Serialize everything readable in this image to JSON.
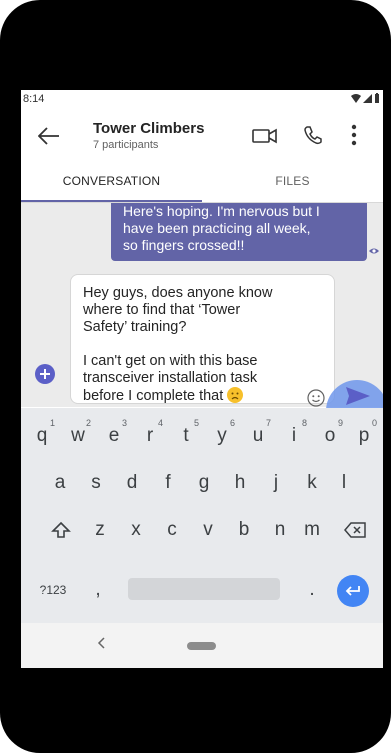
{
  "status_bar": {
    "time": "8:14"
  },
  "header": {
    "title": "Tower Climbers",
    "subtitle": "7 participants"
  },
  "tabs": [
    {
      "label": "CONVERSATION",
      "active": true
    },
    {
      "label": "FILES",
      "active": false
    }
  ],
  "messages": [
    {
      "type": "sent",
      "lines": [
        "Here's hoping. I'm nervous but I",
        "have been practicing all week,",
        "so fingers crossed!!"
      ]
    }
  ],
  "compose": {
    "lines": [
      "Hey guys, does anyone know",
      "where to find that ‘Tower",
      "Safety’ training?",
      "",
      "I can't get on with this base",
      "transceiver installation task",
      "before I complete that"
    ],
    "trailing_emoji": "sad-face"
  },
  "keyboard": {
    "row1": [
      {
        "key": "q",
        "num": "1"
      },
      {
        "key": "w",
        "num": "2"
      },
      {
        "key": "e",
        "num": "3"
      },
      {
        "key": "r",
        "num": "4"
      },
      {
        "key": "t",
        "num": "5"
      },
      {
        "key": "y",
        "num": "6"
      },
      {
        "key": "u",
        "num": "7"
      },
      {
        "key": "i",
        "num": "8"
      },
      {
        "key": "o",
        "num": "9"
      },
      {
        "key": "p",
        "num": "0"
      }
    ],
    "row2": [
      "a",
      "s",
      "d",
      "f",
      "g",
      "h",
      "j",
      "k",
      "l"
    ],
    "row3": [
      "z",
      "x",
      "c",
      "v",
      "b",
      "n",
      "m"
    ],
    "row4": {
      "symbols": "?123",
      "comma": ",",
      "period": "."
    }
  },
  "colors": {
    "brand": "#6264a7",
    "send_highlight": "#6e96eb",
    "enter_key": "#4285f4"
  },
  "icons": {
    "back": "arrow-left-icon",
    "video": "video-camera-icon",
    "call": "phone-icon",
    "more": "more-vertical-icon",
    "add": "plus-icon",
    "emoji": "emoji-icon",
    "send": "send-icon"
  }
}
